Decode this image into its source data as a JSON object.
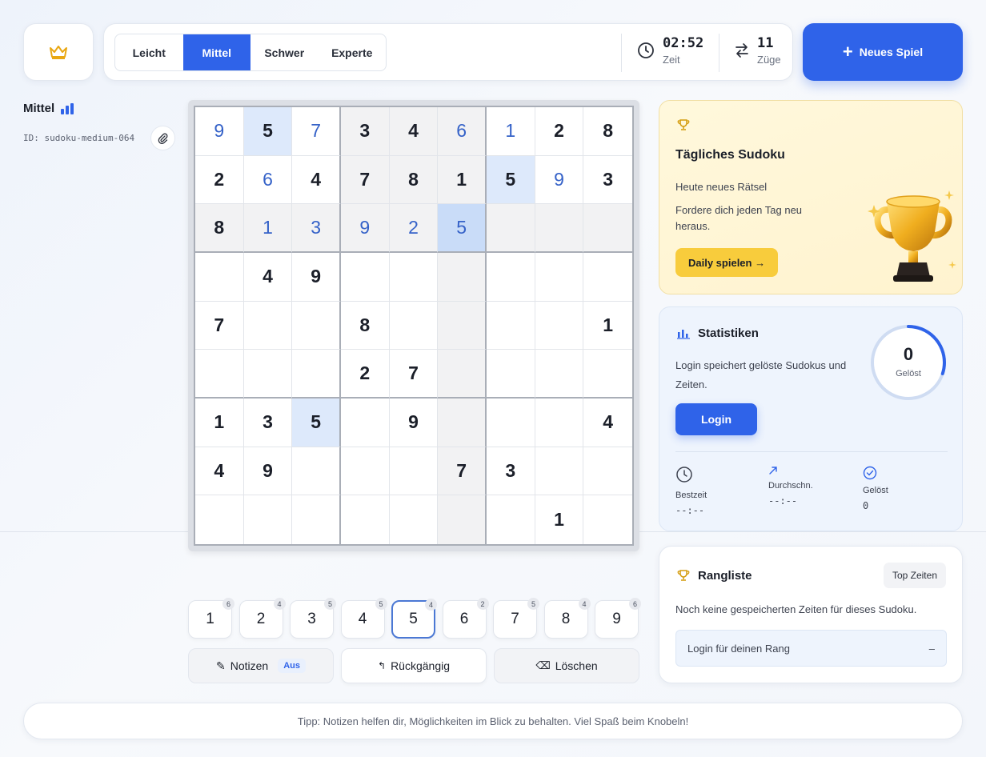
{
  "header": {
    "difficulties": [
      "Leicht",
      "Mittel",
      "Schwer",
      "Experte"
    ],
    "active_difficulty": "Mittel",
    "time_value": "02:52",
    "time_label": "Zeit",
    "moves_value": "11",
    "moves_label": "Züge",
    "new_game_label": "Neues Spiel"
  },
  "puzzle": {
    "level": "Mittel",
    "id_text": "ID: sudoku-medium-064"
  },
  "board": {
    "rows": [
      [
        "9",
        "5",
        "7",
        "3",
        "4",
        "6",
        "1",
        "2",
        "8"
      ],
      [
        "2",
        "6",
        "4",
        "7",
        "8",
        "1",
        "5",
        "9",
        "3"
      ],
      [
        "8",
        "1",
        "3",
        "9",
        "2",
        "5",
        "",
        "",
        ""
      ],
      [
        "",
        "4",
        "9",
        "",
        "",
        "",
        "",
        "",
        ""
      ],
      [
        "7",
        "",
        "",
        "8",
        "",
        "",
        "",
        "",
        "1"
      ],
      [
        "",
        "",
        "",
        "2",
        "7",
        "",
        "",
        "",
        ""
      ],
      [
        "1",
        "3",
        "5",
        "",
        "9",
        "",
        "",
        "",
        "4"
      ],
      [
        "4",
        "9",
        "",
        "",
        "",
        "7",
        "3",
        "",
        ""
      ],
      [
        "",
        "",
        "",
        "",
        "",
        "",
        "",
        "1",
        ""
      ]
    ],
    "user_entered": [
      [
        0,
        0
      ],
      [
        0,
        2
      ],
      [
        0,
        5
      ],
      [
        0,
        6
      ],
      [
        1,
        1
      ],
      [
        1,
        7
      ],
      [
        2,
        1
      ],
      [
        2,
        2
      ],
      [
        2,
        3
      ],
      [
        2,
        4
      ],
      [
        2,
        5
      ]
    ],
    "selected": [
      2,
      5
    ],
    "same_number": [
      [
        0,
        1
      ],
      [
        1,
        6
      ],
      [
        6,
        2
      ]
    ]
  },
  "numpad": {
    "digits": [
      "1",
      "2",
      "3",
      "4",
      "5",
      "6",
      "7",
      "8",
      "9"
    ],
    "counts": [
      "6",
      "4",
      "5",
      "5",
      "4",
      "2",
      "5",
      "4",
      "6"
    ],
    "active_digit": "5"
  },
  "actions": {
    "notes_label": "Notizen",
    "notes_state": "Aus",
    "undo_label": "Rückgängig",
    "delete_label": "Löschen"
  },
  "daily": {
    "title": "Tägliches Sudoku",
    "line1": "Heute neues Rätsel",
    "line2": "Fordere dich jeden Tag neu heraus.",
    "button": "Daily spielen →"
  },
  "stats": {
    "title": "Statistiken",
    "description": "Login speichert gelöste Sudokus und Zeiten.",
    "login_button": "Login",
    "solved_count": "0",
    "solved_label": "Gelöst",
    "solved_fraction": 0.3,
    "best_label": "Bestzeit",
    "best_value": "--:--",
    "avg_label": "Durchschn.",
    "avg_value": "--:--",
    "done_label": "Gelöst",
    "done_value": "0"
  },
  "ranking": {
    "title": "Rangliste",
    "badge": "Top Zeiten",
    "empty_text": "Noch keine gespeicherten Zeiten für dieses Sudoku.",
    "row_label": "Login für deinen Rang",
    "row_value": "–"
  },
  "tip": "Tipp: Notizen helfen dir, Möglichkeiten im Blick zu behalten. Viel Spaß beim Knobeln!",
  "colors": {
    "accent": "#2f63e9",
    "user_digit": "#3562c8",
    "daily_button": "#f8cc3c"
  }
}
